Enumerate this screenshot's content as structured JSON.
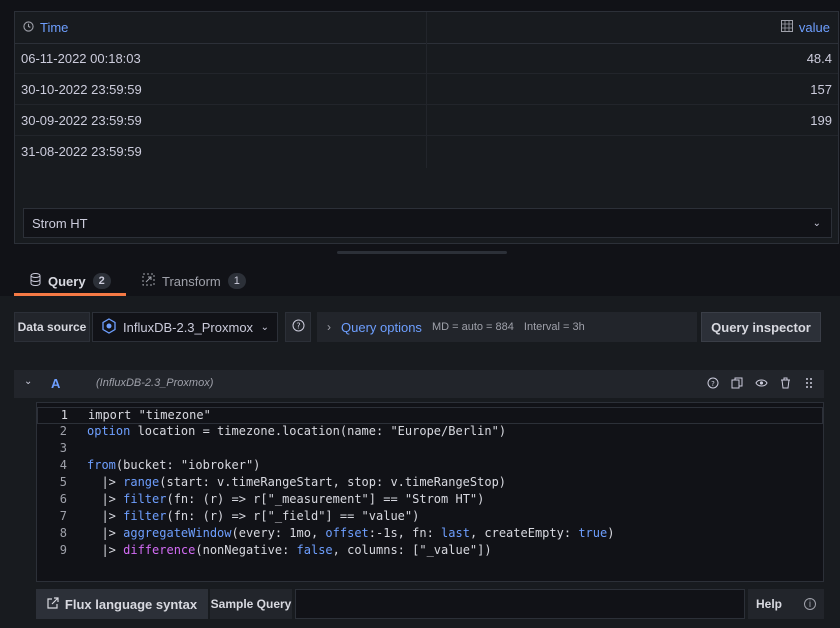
{
  "table": {
    "columns": {
      "time": "Time",
      "value": "value"
    },
    "rows": [
      {
        "time": "06-11-2022 00:18:03",
        "value": "48.4"
      },
      {
        "time": "30-10-2022 23:59:59",
        "value": "157"
      },
      {
        "time": "30-09-2022 23:59:59",
        "value": "199"
      },
      {
        "time": "31-08-2022 23:59:59",
        "value": ""
      }
    ],
    "series_select": "Strom HT"
  },
  "tabs": [
    {
      "label": "Query",
      "count": "2",
      "active": true
    },
    {
      "label": "Transform",
      "count": "1",
      "active": false
    }
  ],
  "datasource": {
    "label": "Data source",
    "selected": "InfluxDB-2.3_Proxmox",
    "query_options_label": "Query options",
    "md": "MD = auto = 884",
    "interval": "Interval = 3h",
    "inspector_label": "Query inspector"
  },
  "query_row": {
    "letter": "A",
    "source": "(InfluxDB-2.3_Proxmox)"
  },
  "code_lines": [
    "import \"timezone\"",
    "option location = timezone.location(name: \"Europe/Berlin\")",
    "",
    "from(bucket: \"iobroker\")",
    "  |> range(start: v.timeRangeStart, stop: v.timeRangeStop)",
    "  |> filter(fn: (r) => r[\"_measurement\"] == \"Strom HT\")",
    "  |> filter(fn: (r) => r[\"_field\"] == \"value\")",
    "  |> aggregateWindow(every: 1mo, offset:-1s, fn: last, createEmpty: true)",
    "  |> difference(nonNegative: false, columns: [\"_value\"])"
  ],
  "bottom": {
    "flux_syntax_label": "Flux language syntax",
    "sample_query_label": "Sample Query",
    "help_label": "Help"
  }
}
